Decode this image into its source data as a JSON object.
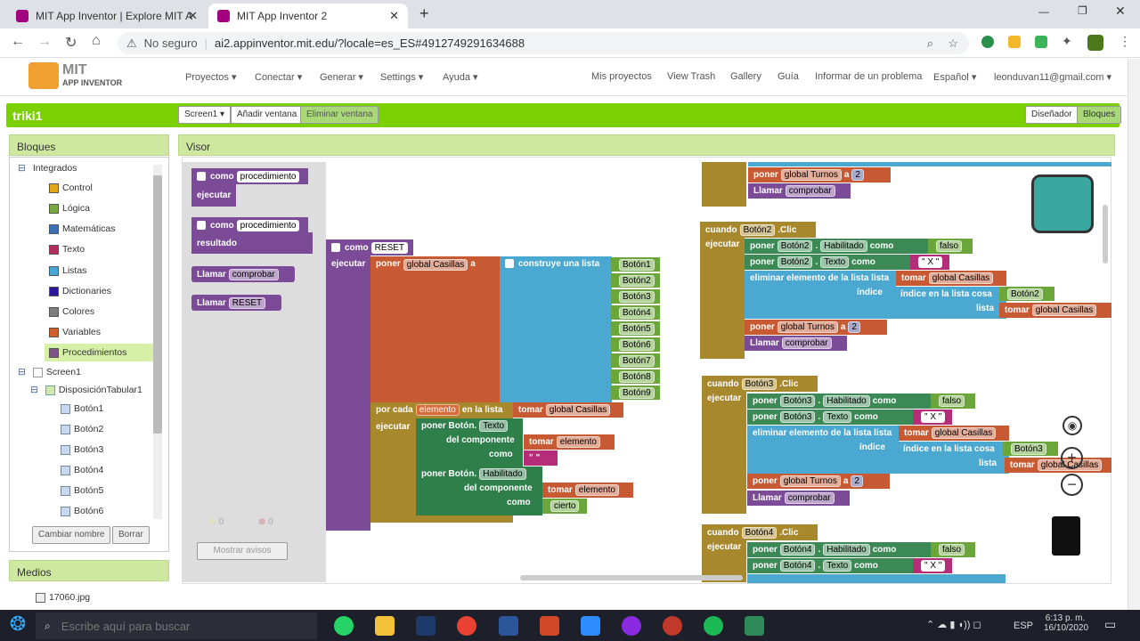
{
  "browser": {
    "tabs": [
      {
        "title": "MIT App Inventor | Explore MIT A",
        "active": false
      },
      {
        "title": "MIT App Inventor 2",
        "active": true
      }
    ],
    "security": "No seguro",
    "url": "ai2.appinventor.mit.edu/?locale=es_ES#4912749291634688"
  },
  "app": {
    "logo_top": "MIT",
    "logo_bottom": "APP INVENTOR",
    "menu": [
      "Proyectos",
      "Conectar",
      "Generar",
      "Settings",
      "Ayuda"
    ],
    "right_menu": [
      "Mis proyectos",
      "View Trash",
      "Gallery",
      "Guía",
      "Informar de un problema",
      "Español",
      "leonduvan11@gmail.com"
    ],
    "project": "triki1",
    "screen_btn": "Screen1",
    "add_screen": "Añadir ventana",
    "remove_screen": "Eliminar ventana",
    "designer": "Diseñador",
    "blocks_btn": "Bloques"
  },
  "panels": {
    "blocks": "Bloques",
    "viewer": "Visor",
    "media": "Medios",
    "rename": "Cambiar nombre",
    "delete": "Borrar",
    "warnings": "Mostrar avisos",
    "warn_count": "0",
    "err_count": "0",
    "media_file": "17060.jpg"
  },
  "tree": {
    "builtin": "Integrados",
    "items": [
      {
        "label": "Control",
        "color": "#e1a91a"
      },
      {
        "label": "Lógica",
        "color": "#77ab41"
      },
      {
        "label": "Matemáticas",
        "color": "#3f71b5"
      },
      {
        "label": "Texto",
        "color": "#b32d5e"
      },
      {
        "label": "Listas",
        "color": "#49a6d4"
      },
      {
        "label": "Dictionaries",
        "color": "#2d1799"
      },
      {
        "label": "Colores",
        "color": "#7d7d7d"
      },
      {
        "label": "Variables",
        "color": "#d05f2d"
      },
      {
        "label": "Procedimientos",
        "color": "#7c5385"
      }
    ],
    "screen": "Screen1",
    "layout": "DisposiciónTabular1",
    "buttons": [
      "Botón1",
      "Botón2",
      "Botón3",
      "Botón4",
      "Botón5",
      "Botón6"
    ]
  },
  "flyout": {
    "proc_do": "como",
    "proc_name": "procedimiento",
    "do": "ejecutar",
    "proc_ret": "como",
    "result": "resultado",
    "call1": "Llamar",
    "call1_name": "comprobar",
    "call2": "Llamar",
    "call2_name": "RESET"
  },
  "reset": {
    "como": "como",
    "name": "RESET",
    "ejecutar": "ejecutar",
    "poner": "poner",
    "var": "global Casillas",
    "a": "a",
    "construye": "construye una lista",
    "list": [
      "Botón1",
      "Botón2",
      "Botón3",
      "Botón4",
      "Botón5",
      "Botón6",
      "Botón7",
      "Botón8",
      "Botón9"
    ],
    "for_each": "por cada",
    "elemento": "elemento",
    "en_lista": "en la lista",
    "tomar": "tomar",
    "tomar_var": "global Casillas",
    "poner_boton": "poner Botón.",
    "texto": "Texto",
    "del_comp": "del componente",
    "tomar_el": "tomar",
    "elemento2": "elemento",
    "empty": "\" \"",
    "habilitado": "Habilitado",
    "cierto": "cierto"
  },
  "events": [
    {
      "cuando": "cuando",
      "btn": "Botón2",
      "clic": ".Clic",
      "ejecutar": "ejecutar",
      "poner": "poner",
      "hab": "Habilitado",
      "como": "como",
      "falso": "falso",
      "texto": "Texto",
      "x": "\" X \"",
      "elim": "eliminar elemento de la lista lista",
      "tomar": "tomar",
      "casillas": "global Casillas",
      "indice": "índice",
      "indice_en": "índice en la lista cosa",
      "lista": "lista",
      "turnos": "global Turnos",
      "a": "a",
      "num": "2",
      "llamar": "Llamar",
      "comprobar": "comprobar"
    },
    {
      "cuando": "cuando",
      "btn": "Botón3",
      "clic": ".Clic",
      "ejecutar": "ejecutar",
      "poner": "poner",
      "hab": "Habilitado",
      "como": "como",
      "falso": "falso",
      "texto": "Texto",
      "x": "\" X \"",
      "elim": "eliminar elemento de la lista lista",
      "tomar": "tomar",
      "casillas": "global Casillas",
      "indice": "índice",
      "indice_en": "índice en la lista cosa",
      "lista": "lista",
      "turnos": "global Turnos",
      "a": "a",
      "num": "2",
      "llamar": "Llamar",
      "comprobar": "comprobar"
    },
    {
      "cuando": "cuando",
      "btn": "Botón4",
      "clic": ".Clic",
      "ejecutar": "ejecutar",
      "poner": "poner",
      "hab": "Habilitado",
      "como": "como",
      "falso": "falso",
      "texto": "Texto",
      "x": "\" X \""
    }
  ],
  "top_partial": {
    "poner": "poner",
    "turnos": "global Turnos",
    "a": "a",
    "num": "2",
    "llamar": "Llamar",
    "comprobar": "comprobar"
  },
  "taskbar": {
    "search": "Escribe aquí para buscar",
    "lang": "ESP",
    "time": "6:13 p. m.",
    "date": "16/10/2020"
  }
}
